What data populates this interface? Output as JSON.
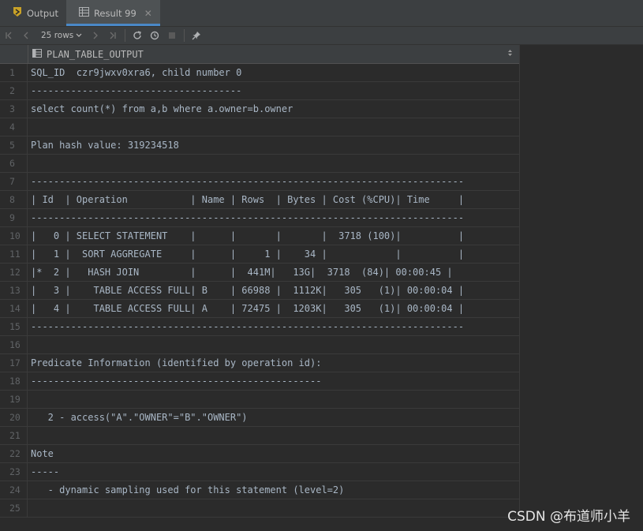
{
  "tabs": [
    {
      "label": "Output",
      "icon": "output-icon"
    },
    {
      "label": "Result 99",
      "icon": "table-icon",
      "close": "✕"
    }
  ],
  "toolbar": {
    "rows_label": "25 rows"
  },
  "grid": {
    "column_header": "PLAN_TABLE_OUTPUT",
    "rows": [
      {
        "n": "1",
        "text": "SQL_ID  czr9jwxv0xra6, child number 0"
      },
      {
        "n": "2",
        "text": "-------------------------------------"
      },
      {
        "n": "3",
        "text": "select count(*) from a,b where a.owner=b.owner"
      },
      {
        "n": "4",
        "text": ""
      },
      {
        "n": "5",
        "text": "Plan hash value: 319234518"
      },
      {
        "n": "6",
        "text": ""
      },
      {
        "n": "7",
        "text": "----------------------------------------------------------------------------"
      },
      {
        "n": "8",
        "text": "| Id  | Operation           | Name | Rows  | Bytes | Cost (%CPU)| Time     |"
      },
      {
        "n": "9",
        "text": "----------------------------------------------------------------------------"
      },
      {
        "n": "10",
        "text": "|   0 | SELECT STATEMENT    |      |       |       |  3718 (100)|          |"
      },
      {
        "n": "11",
        "text": "|   1 |  SORT AGGREGATE     |      |     1 |    34 |            |          |"
      },
      {
        "n": "12",
        "text": "|*  2 |   HASH JOIN         |      |  441M|   13G|  3718  (84)| 00:00:45 |"
      },
      {
        "n": "13",
        "text": "|   3 |    TABLE ACCESS FULL| B    | 66988 |  1112K|   305   (1)| 00:00:04 |"
      },
      {
        "n": "14",
        "text": "|   4 |    TABLE ACCESS FULL| A    | 72475 |  1203K|   305   (1)| 00:00:04 |"
      },
      {
        "n": "15",
        "text": "----------------------------------------------------------------------------"
      },
      {
        "n": "16",
        "text": ""
      },
      {
        "n": "17",
        "text": "Predicate Information (identified by operation id):"
      },
      {
        "n": "18",
        "text": "---------------------------------------------------"
      },
      {
        "n": "19",
        "text": ""
      },
      {
        "n": "20",
        "text": "   2 - access(\"A\".\"OWNER\"=\"B\".\"OWNER\")"
      },
      {
        "n": "21",
        "text": ""
      },
      {
        "n": "22",
        "text": "Note"
      },
      {
        "n": "23",
        "text": "-----"
      },
      {
        "n": "24",
        "text": "   - dynamic sampling used for this statement (level=2)"
      },
      {
        "n": "25",
        "text": ""
      }
    ]
  },
  "watermark": "CSDN @布道师小羊",
  "colors": {
    "background": "#2b2b2b",
    "toolbar": "#3c3f41",
    "text": "#a9b7c6",
    "row_number": "#606366",
    "accent": "#4a88c7"
  }
}
